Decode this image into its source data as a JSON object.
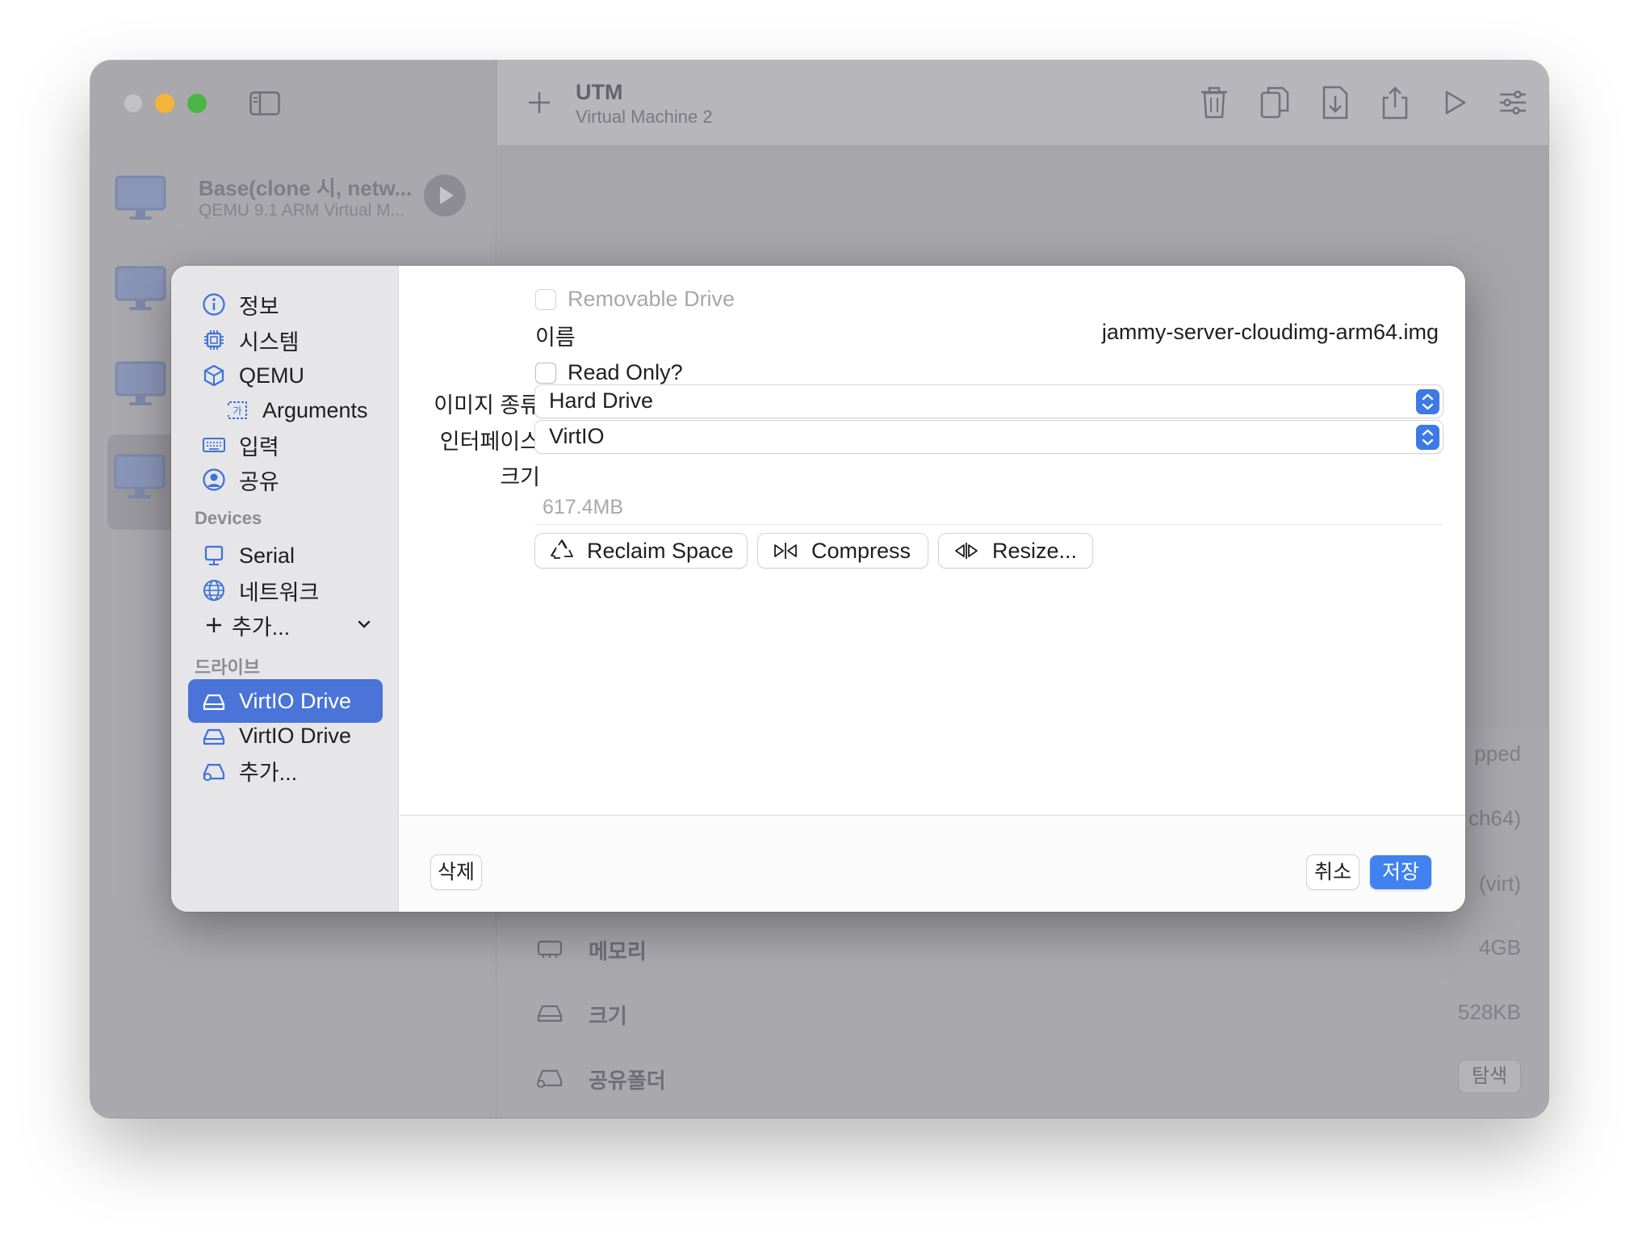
{
  "window": {
    "toolbar": {
      "title": "UTM",
      "subtitle": "Virtual Machine 2"
    },
    "vm_list": [
      {
        "title": "Base(clone 시, netw...",
        "subtitle": "QEMU 9.1 ARM Virtual M..."
      }
    ],
    "details": [
      {
        "label": "메모리",
        "value": "4GB",
        "icon": "memory-chip-icon"
      },
      {
        "label": "크기",
        "value": "528KB",
        "icon": "drive-icon"
      },
      {
        "label": "공유폴더",
        "value": "",
        "button": "탐색",
        "icon": "shared-drive-icon"
      }
    ],
    "peek": {
      "status_partial": "pped",
      "arch_partial": "ch64)",
      "machine_partial": "(virt)"
    }
  },
  "settings_sheet": {
    "nav": {
      "items": [
        {
          "label": "정보",
          "icon": "info-icon"
        },
        {
          "label": "시스템",
          "icon": "cpu-chip-icon"
        },
        {
          "label": "QEMU",
          "icon": "cube-icon"
        },
        {
          "label": "Arguments",
          "icon": "arguments-icon"
        },
        {
          "label": "입력",
          "icon": "keyboard-icon"
        },
        {
          "label": "공유",
          "icon": "person-circle-icon"
        }
      ],
      "devices_header": "Devices",
      "devices": [
        {
          "label": "Serial",
          "icon": "monitor-icon"
        },
        {
          "label": "네트워크",
          "icon": "globe-icon"
        },
        {
          "label": "추가...",
          "icon": "plus-icon"
        }
      ],
      "drives_header": "드라이브",
      "drives": [
        {
          "label": "VirtIO Drive",
          "icon": "drive-icon",
          "selected": true
        },
        {
          "label": "VirtIO Drive",
          "icon": "drive-icon",
          "selected": false
        },
        {
          "label": "추가...",
          "icon": "add-drive-icon"
        }
      ]
    },
    "form": {
      "removable_label": "Removable Drive",
      "name_label": "이름",
      "name_value": "jammy-server-cloudimg-arm64.img",
      "readonly_label": "Read Only?",
      "image_type_label": "이미지 종류",
      "image_type_value": "Hard Drive",
      "interface_label": "인터페이스",
      "interface_value": "VirtIO",
      "size_label": "크기",
      "size_value": "617.4MB",
      "actions": {
        "reclaim": "Reclaim Space",
        "compress": "Compress",
        "resize": "Resize..."
      }
    },
    "footer": {
      "delete": "삭제",
      "cancel": "취소",
      "save": "저장"
    },
    "colors": {
      "accent": "#3f82f0",
      "selection": "#4a74d8"
    }
  }
}
